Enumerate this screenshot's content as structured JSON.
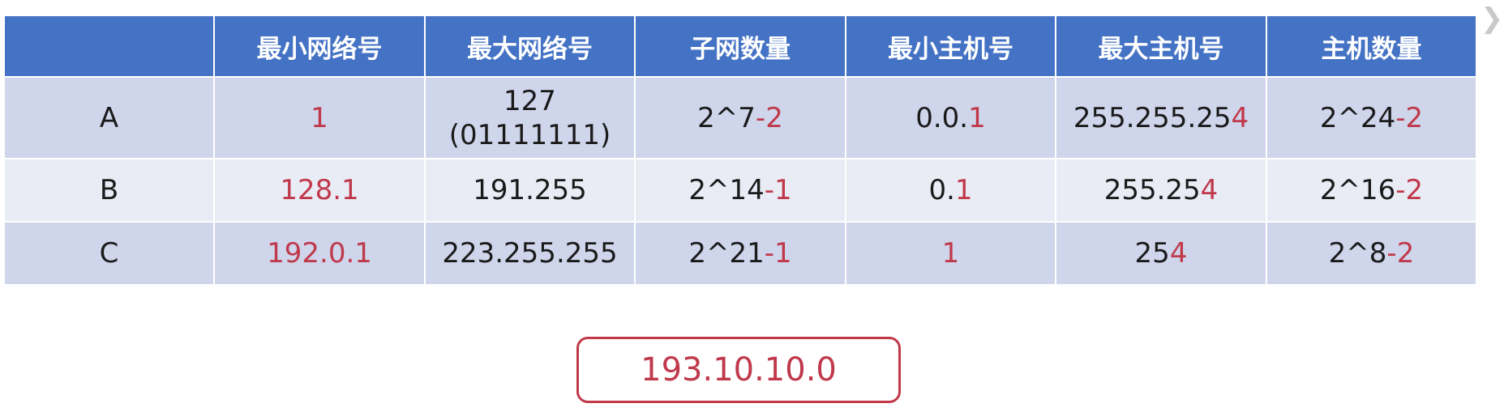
{
  "table": {
    "headers": [
      "",
      "最小网络号",
      "最大网络号",
      "子网数量",
      "最小主机号",
      "最大主机号",
      "主机数量"
    ],
    "rows": [
      {
        "class": "A",
        "min_network": [
          {
            "t": "1",
            "red": true
          }
        ],
        "max_network_line1": "127",
        "max_network_line2": "(01111111)",
        "subnet_count": [
          {
            "t": "2^7",
            "red": false
          },
          {
            "t": "-2",
            "red": true
          }
        ],
        "min_host": [
          {
            "t": "0.0.",
            "red": false
          },
          {
            "t": "1",
            "red": true
          }
        ],
        "max_host": [
          {
            "t": "255.255.25",
            "red": false
          },
          {
            "t": "4",
            "red": true
          }
        ],
        "host_count": [
          {
            "t": "2^24",
            "red": false
          },
          {
            "t": "-2",
            "red": true
          }
        ]
      },
      {
        "class": "B",
        "min_network": [
          {
            "t": "128.1",
            "red": true
          }
        ],
        "max_network_line1": "191.255",
        "subnet_count": [
          {
            "t": "2^14",
            "red": false
          },
          {
            "t": "-1",
            "red": true
          }
        ],
        "min_host": [
          {
            "t": "0.",
            "red": false
          },
          {
            "t": "1",
            "red": true
          }
        ],
        "max_host": [
          {
            "t": "255.25",
            "red": false
          },
          {
            "t": "4",
            "red": true
          }
        ],
        "host_count": [
          {
            "t": "2^16",
            "red": false
          },
          {
            "t": "-2",
            "red": true
          }
        ]
      },
      {
        "class": "C",
        "min_network": [
          {
            "t": "192.0.1",
            "red": true
          }
        ],
        "max_network_line1": "223.255.255",
        "subnet_count": [
          {
            "t": "2^21",
            "red": false
          },
          {
            "t": "-1",
            "red": true
          }
        ],
        "min_host": [
          {
            "t": "1",
            "red": true
          }
        ],
        "max_host": [
          {
            "t": "25",
            "red": false
          },
          {
            "t": "4",
            "red": true
          }
        ],
        "host_count": [
          {
            "t": "2^8",
            "red": false
          },
          {
            "t": "-2",
            "red": true
          }
        ]
      }
    ]
  },
  "callout": {
    "text": "193.10.10.0"
  },
  "nav": {
    "next_icon": "chevron-right-icon"
  },
  "colors": {
    "header_bg": "#4472c4",
    "row_dark": "#cfd5ea",
    "row_light": "#e9ebf5",
    "accent_red": "#c0394b"
  }
}
